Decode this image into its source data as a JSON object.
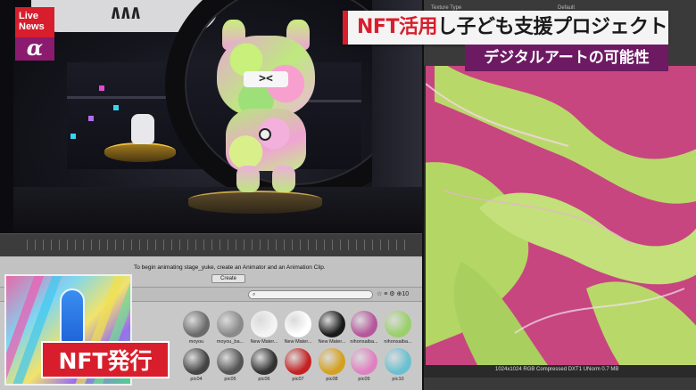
{
  "broadcast": {
    "logo_live": "Live",
    "logo_news": "News",
    "logo_alpha": "α",
    "headline_red": "NFT活用",
    "headline_rest": "し子ども支援プロジェクト",
    "subhead": "デジタルアートの可能性",
    "caption": "NFT発行",
    "colors": {
      "accent_red": "#d81e2c",
      "accent_purple": "#6d1a63"
    }
  },
  "scene": {
    "logo_text": "∧∧∧"
  },
  "animation": {
    "message": "To begin animating stage_yuke, create an Animator and an Animation Clip.",
    "create_button": "Create"
  },
  "assets": {
    "tools": "☆ ≡ ⚙ ⊕10",
    "row1": [
      "",
      "",
      "moyou",
      "moyou_ba...",
      "New Mater...",
      "New Mater...",
      "New Mater...",
      "nihonsaiba...",
      "nihonsaiba..."
    ],
    "row2": [
      "",
      "",
      "pic04",
      "pic05",
      "pic06",
      "pic07",
      "pic08",
      "pic09",
      "pic10"
    ]
  },
  "texture": {
    "type_label": "Texture Type",
    "type_value": "Default",
    "info": "1024x1024  RGB Compressed DXT1 UNorm   0.7 MB"
  }
}
